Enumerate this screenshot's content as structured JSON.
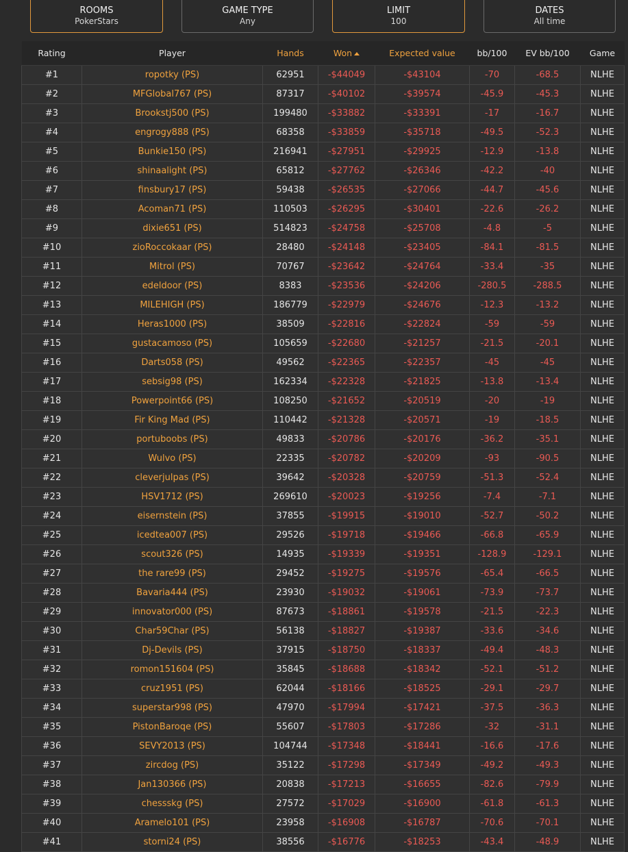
{
  "filters": [
    {
      "title": "ROOMS",
      "value": "PokerStars",
      "active": true
    },
    {
      "title": "GAME TYPE",
      "value": "Any",
      "active": false
    },
    {
      "title": "LIMIT",
      "value": "100",
      "active": true
    },
    {
      "title": "DATES",
      "value": "All time",
      "active": false
    }
  ],
  "table": {
    "columns": [
      "Rating",
      "Player",
      "Hands",
      "Won",
      "Expected value",
      "bb/100",
      "EV bb/100",
      "Game"
    ],
    "sorted_column": "Won",
    "sort_direction": "ascending",
    "rows": [
      [
        "#1",
        "ropotky (PS)",
        "62951",
        "-$44049",
        "-$43104",
        "-70",
        "-68.5",
        "NLHE"
      ],
      [
        "#2",
        "MFGlobal767 (PS)",
        "87317",
        "-$40102",
        "-$39574",
        "-45.9",
        "-45.3",
        "NLHE"
      ],
      [
        "#3",
        "Brookstj500 (PS)",
        "199480",
        "-$33882",
        "-$33391",
        "-17",
        "-16.7",
        "NLHE"
      ],
      [
        "#4",
        "engrogy888 (PS)",
        "68358",
        "-$33859",
        "-$35718",
        "-49.5",
        "-52.3",
        "NLHE"
      ],
      [
        "#5",
        "Bunkie150 (PS)",
        "216941",
        "-$27951",
        "-$29925",
        "-12.9",
        "-13.8",
        "NLHE"
      ],
      [
        "#6",
        "shinaalight (PS)",
        "65812",
        "-$27762",
        "-$26346",
        "-42.2",
        "-40",
        "NLHE"
      ],
      [
        "#7",
        "finsbury17 (PS)",
        "59438",
        "-$26535",
        "-$27066",
        "-44.7",
        "-45.6",
        "NLHE"
      ],
      [
        "#8",
        "Acoman71 (PS)",
        "110503",
        "-$26295",
        "-$30401",
        "-22.6",
        "-26.2",
        "NLHE"
      ],
      [
        "#9",
        "dixie651 (PS)",
        "514823",
        "-$24758",
        "-$25708",
        "-4.8",
        "-5",
        "NLHE"
      ],
      [
        "#10",
        "zioRoccokaar (PS)",
        "28480",
        "-$24148",
        "-$23405",
        "-84.1",
        "-81.5",
        "NLHE"
      ],
      [
        "#11",
        "Mitrol (PS)",
        "70767",
        "-$23642",
        "-$24764",
        "-33.4",
        "-35",
        "NLHE"
      ],
      [
        "#12",
        "edeldoor (PS)",
        "8383",
        "-$23536",
        "-$24206",
        "-280.5",
        "-288.5",
        "NLHE"
      ],
      [
        "#13",
        "MILEHIGH (PS)",
        "186779",
        "-$22979",
        "-$24676",
        "-12.3",
        "-13.2",
        "NLHE"
      ],
      [
        "#14",
        "Heras1000 (PS)",
        "38509",
        "-$22816",
        "-$22824",
        "-59",
        "-59",
        "NLHE"
      ],
      [
        "#15",
        "gustacamoso (PS)",
        "105659",
        "-$22680",
        "-$21257",
        "-21.5",
        "-20.1",
        "NLHE"
      ],
      [
        "#16",
        "Darts058 (PS)",
        "49562",
        "-$22365",
        "-$22357",
        "-45",
        "-45",
        "NLHE"
      ],
      [
        "#17",
        "sebsig98 (PS)",
        "162334",
        "-$22328",
        "-$21825",
        "-13.8",
        "-13.4",
        "NLHE"
      ],
      [
        "#18",
        "Powerpoint66 (PS)",
        "108250",
        "-$21652",
        "-$20519",
        "-20",
        "-19",
        "NLHE"
      ],
      [
        "#19",
        "Fir King Mad (PS)",
        "110442",
        "-$21328",
        "-$20571",
        "-19",
        "-18.5",
        "NLHE"
      ],
      [
        "#20",
        "portuboobs (PS)",
        "49833",
        "-$20786",
        "-$20176",
        "-36.2",
        "-35.1",
        "NLHE"
      ],
      [
        "#21",
        "Wulvo (PS)",
        "22335",
        "-$20782",
        "-$20209",
        "-93",
        "-90.5",
        "NLHE"
      ],
      [
        "#22",
        "cleverjulpas (PS)",
        "39642",
        "-$20328",
        "-$20759",
        "-51.3",
        "-52.4",
        "NLHE"
      ],
      [
        "#23",
        "HSV1712 (PS)",
        "269610",
        "-$20023",
        "-$19256",
        "-7.4",
        "-7.1",
        "NLHE"
      ],
      [
        "#24",
        "eisernstein (PS)",
        "37855",
        "-$19915",
        "-$19010",
        "-52.7",
        "-50.2",
        "NLHE"
      ],
      [
        "#25",
        "icedtea007 (PS)",
        "29526",
        "-$19718",
        "-$19466",
        "-66.8",
        "-65.9",
        "NLHE"
      ],
      [
        "#26",
        "scout326 (PS)",
        "14935",
        "-$19339",
        "-$19351",
        "-128.9",
        "-129.1",
        "NLHE"
      ],
      [
        "#27",
        "the rare99 (PS)",
        "29452",
        "-$19275",
        "-$19576",
        "-65.4",
        "-66.5",
        "NLHE"
      ],
      [
        "#28",
        "Bavaria444 (PS)",
        "23930",
        "-$19032",
        "-$19061",
        "-73.9",
        "-73.7",
        "NLHE"
      ],
      [
        "#29",
        "innovator000 (PS)",
        "87673",
        "-$18861",
        "-$19578",
        "-21.5",
        "-22.3",
        "NLHE"
      ],
      [
        "#30",
        "Char59Char (PS)",
        "56138",
        "-$18827",
        "-$19387",
        "-33.6",
        "-34.6",
        "NLHE"
      ],
      [
        "#31",
        "Dj-Devils (PS)",
        "37915",
        "-$18750",
        "-$18337",
        "-49.4",
        "-48.3",
        "NLHE"
      ],
      [
        "#32",
        "romon151604 (PS)",
        "35845",
        "-$18688",
        "-$18342",
        "-52.1",
        "-51.2",
        "NLHE"
      ],
      [
        "#33",
        "cruz1951 (PS)",
        "62044",
        "-$18166",
        "-$18525",
        "-29.1",
        "-29.7",
        "NLHE"
      ],
      [
        "#34",
        "superstar998 (PS)",
        "47970",
        "-$17994",
        "-$17421",
        "-37.5",
        "-36.3",
        "NLHE"
      ],
      [
        "#35",
        "PistonBaroqe (PS)",
        "55607",
        "-$17803",
        "-$17286",
        "-32",
        "-31.1",
        "NLHE"
      ],
      [
        "#36",
        "SEVY2013 (PS)",
        "104744",
        "-$17348",
        "-$18441",
        "-16.6",
        "-17.6",
        "NLHE"
      ],
      [
        "#37",
        "zircdog (PS)",
        "35122",
        "-$17298",
        "-$17349",
        "-49.2",
        "-49.3",
        "NLHE"
      ],
      [
        "#38",
        "Jan130366 (PS)",
        "20838",
        "-$17213",
        "-$16655",
        "-82.6",
        "-79.9",
        "NLHE"
      ],
      [
        "#39",
        "chessskg (PS)",
        "27572",
        "-$17029",
        "-$16900",
        "-61.8",
        "-61.3",
        "NLHE"
      ],
      [
        "#40",
        "Aramelo101 (PS)",
        "23958",
        "-$16908",
        "-$16787",
        "-70.6",
        "-70.1",
        "NLHE"
      ],
      [
        "#41",
        "storni24 (PS)",
        "38556",
        "-$16776",
        "-$18253",
        "-43.4",
        "-48.9",
        "NLHE"
      ]
    ]
  }
}
